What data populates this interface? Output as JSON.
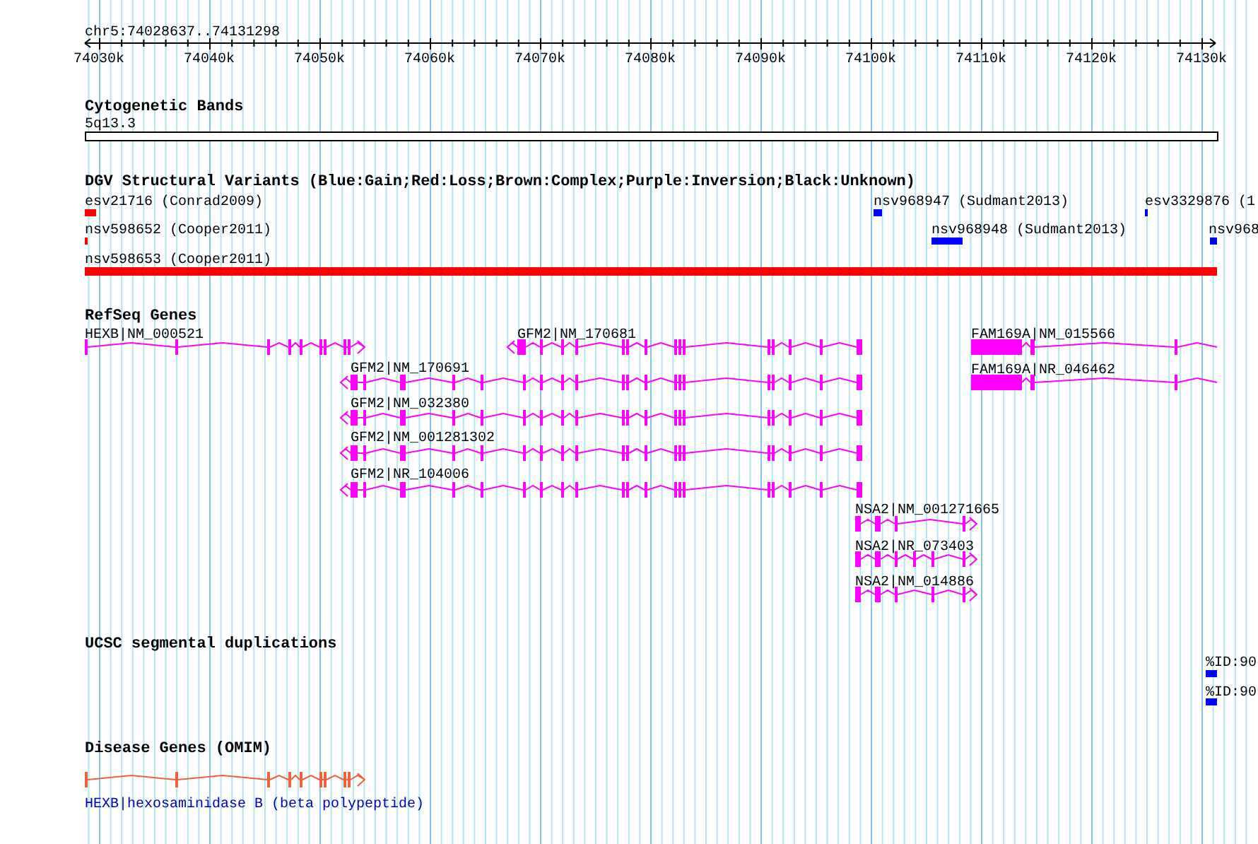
{
  "ruler": {
    "region": "chr5:74028637..74131298",
    "ticks": [
      "74030k",
      "74040k",
      "74050k",
      "74060k",
      "74070k",
      "74080k",
      "74090k",
      "74100k",
      "74110k",
      "74120k",
      "74130k"
    ]
  },
  "cytogenetic_bands": {
    "title": "Cytogenetic Bands",
    "bands": [
      {
        "label": "5q13.3"
      }
    ]
  },
  "dgv_variants": {
    "title": "DGV Structural Variants (Blue:Gain;Red:Loss;Brown:Complex;Purple:Inversion;Black:Unknown)",
    "features": [
      {
        "label": "esv21716 (Conrad2009)",
        "color": "#ff0000"
      },
      {
        "label": "nsv968947 (Sudmant2013)",
        "color": "#0000ff"
      },
      {
        "label": "esv3329876 (1",
        "color": "#0000ff"
      },
      {
        "label": "nsv598652 (Cooper2011)",
        "color": "#ff0000"
      },
      {
        "label": "nsv968948 (Sudmant2013)",
        "color": "#0000ff"
      },
      {
        "label": "nsv968",
        "color": "#0000ff"
      },
      {
        "label": "nsv598653 (Cooper2011)",
        "color": "#ff0000"
      }
    ]
  },
  "refseq_genes": {
    "title": "RefSeq Genes",
    "genes": [
      {
        "label": "HEXB|NM_000521",
        "reverse_strand": false
      },
      {
        "label": "GFM2|NM_170681",
        "reverse_strand": true
      },
      {
        "label": "GFM2|NM_170691",
        "reverse_strand": true
      },
      {
        "label": "GFM2|NM_032380",
        "reverse_strand": true
      },
      {
        "label": "GFM2|NM_001281302",
        "reverse_strand": true
      },
      {
        "label": "GFM2|NR_104006",
        "reverse_strand": true
      },
      {
        "label": "FAM169A|NM_015566"
      },
      {
        "label": "FAM169A|NR_046462"
      },
      {
        "label": "NSA2|NM_001271665",
        "reverse_strand": false
      },
      {
        "label": "NSA2|NR_073403",
        "reverse_strand": false
      },
      {
        "label": "NSA2|NM_014886",
        "reverse_strand": false
      }
    ]
  },
  "segmental_duplications": {
    "title": "UCSC segmental duplications",
    "features": [
      {
        "label": "%ID:90"
      },
      {
        "label": "%ID:90"
      }
    ]
  },
  "disease_genes": {
    "title": "Disease Genes (OMIM)",
    "genes": [
      {
        "label": "HEXB|hexosaminidase B (beta polypeptide)",
        "reverse_strand": false
      }
    ]
  }
}
